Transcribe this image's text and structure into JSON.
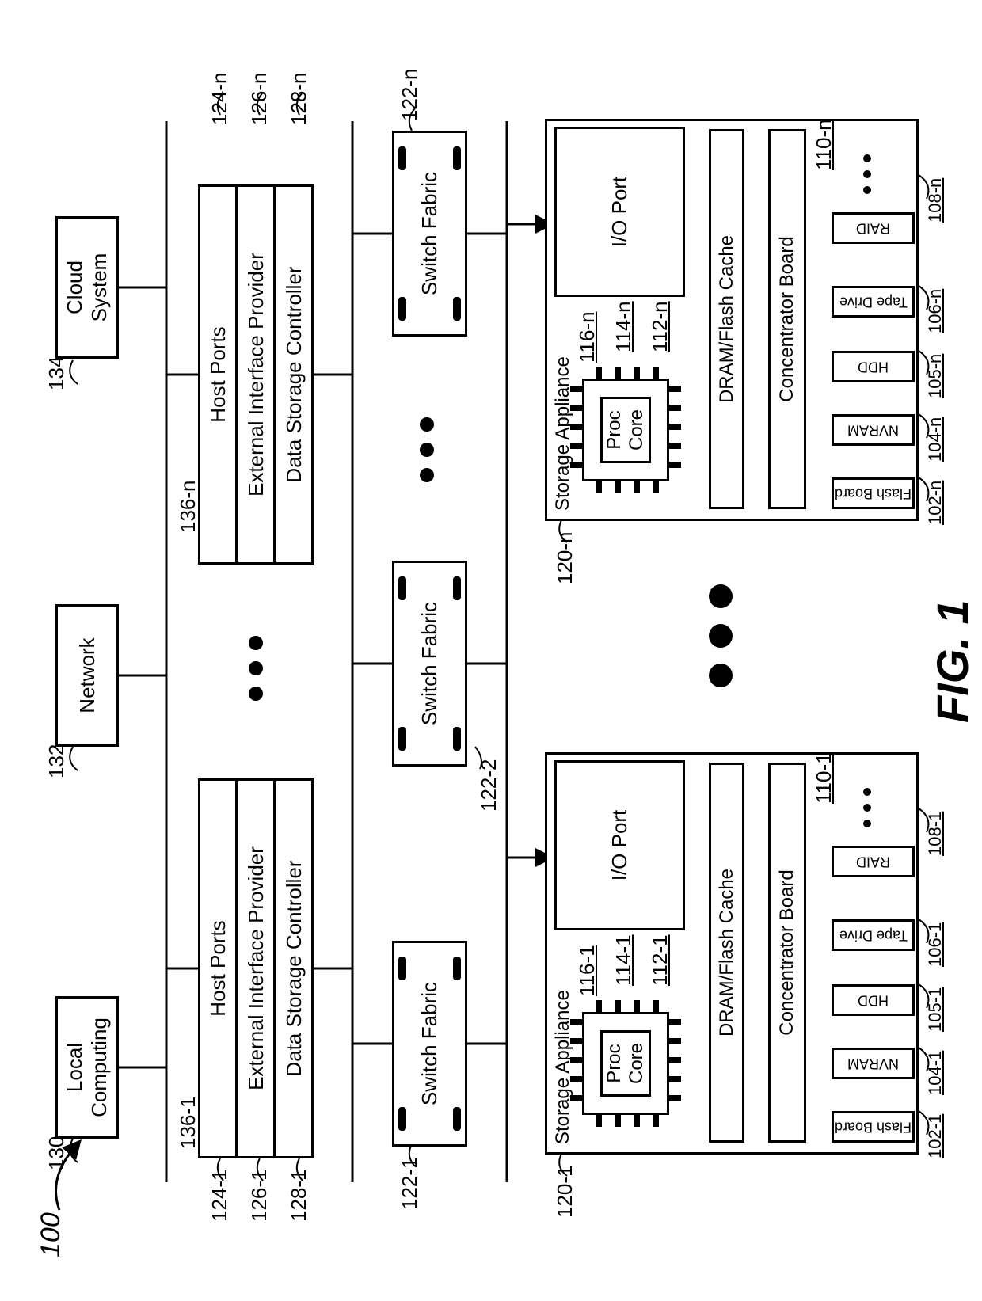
{
  "figure": {
    "title": "FIG. 1",
    "ref": "100"
  },
  "top": {
    "local_computing": "Local\nComputing",
    "network": "Network",
    "cloud_system": "Cloud\nSystem",
    "local_ref": "130",
    "network_ref": "132",
    "cloud_ref": "134"
  },
  "blocks_left": {
    "host_ports": "Host Ports",
    "ext_if": "External Interface Provider",
    "dsc": "Data Storage Controller",
    "ref_136": "136-1",
    "ref_124": "124-1",
    "ref_126": "126-1",
    "ref_128": "128-1"
  },
  "blocks_right": {
    "host_ports": "Host Ports",
    "ext_if": "External Interface Provider",
    "dsc": "Data Storage Controller",
    "ref_136": "136-n",
    "ref_124": "124-n",
    "ref_126": "126-n",
    "ref_128": "128-n"
  },
  "switch_fabric": {
    "label": "Switch Fabric",
    "ref1": "122-1",
    "ref2": "122-2",
    "refn": "122-n"
  },
  "appliances": {
    "title": "Storage Appliance",
    "left": {
      "ref": "120-1",
      "proc_core": "Proc\nCore",
      "proc_refs": [
        "116-1",
        "114-1",
        "112-1"
      ],
      "io_port": "I/O Port",
      "dram": "DRAM/Flash Cache",
      "concentrator": "Concentrator Board",
      "conc_ref": "110-1",
      "devs": [
        "Flash Board",
        "NVRAM",
        "HDD",
        "Tape Drive",
        "RAID"
      ],
      "dev_refs": [
        "102-1",
        "104-1",
        "105-1",
        "106-1",
        "108-1"
      ]
    },
    "right": {
      "ref": "120-n",
      "proc_core": "Proc\nCore",
      "proc_refs": [
        "116-n",
        "114-n",
        "112-n"
      ],
      "io_port": "I/O Port",
      "dram": "DRAM/Flash Cache",
      "concentrator": "Concentrator Board",
      "conc_ref": "110-n",
      "devs": [
        "Flash Board",
        "NVRAM",
        "HDD",
        "Tape Drive",
        "RAID"
      ],
      "dev_refs": [
        "102-n",
        "104-n",
        "105-n",
        "106-n",
        "108-n"
      ]
    }
  }
}
